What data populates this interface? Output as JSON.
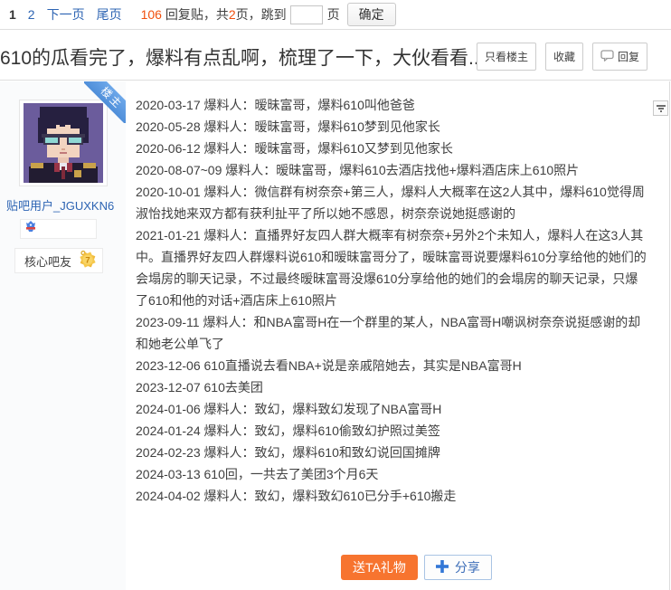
{
  "pagination": {
    "current_page": "1",
    "page_2": "2",
    "next_label": "下一页",
    "last_label": "尾页",
    "reply_count": "106",
    "replies_label": "回复贴，共",
    "total_pages": "2",
    "jump_label": "页，跳到",
    "jump_value": "",
    "page_unit": "页",
    "confirm_label": "确定"
  },
  "header": {
    "title": "610的瓜看完了，爆料有点乱啊，梳理了一下，大伙看看...",
    "only_op_label": "只看楼主",
    "favorite_label": "收藏",
    "reply_label": "回复"
  },
  "sidebar": {
    "ribbon": "楼主",
    "username": "贴吧用户_JGUXKN6",
    "member_title": "核心吧友",
    "level": "7"
  },
  "post": {
    "lines": [
      "2020-03-17 爆料人：暧昧富哥，爆料610叫他爸爸",
      "2020-05-28 爆料人：暧昧富哥，爆料610梦到见他家长",
      "2020-06-12 爆料人：暧昧富哥，爆料610又梦到见他家长",
      "2020-08-07~09 爆料人：暧昧富哥，爆料610去酒店找他+爆料酒店床上610照片",
      "2020-10-01 爆料人：微信群有树奈奈+第三人，爆料人大概率在这2人其中，爆料610觉得周淑怡找她来双方都有获利扯平了所以她不感恩，树奈奈说她挺感谢的",
      "2021-01-21 爆料人：直播界好友四人群大概率有树奈奈+另外2个未知人，爆料人在这3人其中。直播界好友四人群爆料说610和暧昧富哥分了，暧昧富哥说要爆料610分享给他的她们的会塌房的聊天记录，不过最终暧昧富哥没爆610分享给他的她们的会塌房的聊天记录，只爆了610和他的对话+酒店床上610照片",
      "2023-09-11 爆料人：和NBA富哥H在一个群里的某人，NBA富哥H嘲讽树奈奈说挺感谢的却和她老公单飞了",
      "2023-12-06 610直播说去看NBA+说是亲戚陪她去，其实是NBA富哥H",
      "2023-12-07 610去美团",
      "2024-01-06 爆料人：致幻，爆料致幻发现了NBA富哥H",
      "2024-01-24 爆料人：致幻，爆料610偷致幻护照过美签",
      "2024-02-23 爆料人：致幻，爆料610和致幻说回国摊牌",
      "2024-03-13 610回，一共去了美团3个月6天",
      "2024-04-02 爆料人：致幻，爆料致幻610已分手+610搬走"
    ],
    "gift_label": "送TA礼物",
    "share_label": "分享"
  },
  "icons": {
    "reply": "speech-bubble-icon",
    "share": "plus-icon",
    "post_menu": "dropdown-funnel-icon",
    "member_badge": "blue-medal-icon",
    "level_badge": "gold-star-badge"
  },
  "colors": {
    "link": "#2d64b3",
    "count_highlight": "#f0500e",
    "gift_button_bg": "#f7742f",
    "share_accent": "#3377d6",
    "ribbon_bg": "#5f9be0"
  }
}
